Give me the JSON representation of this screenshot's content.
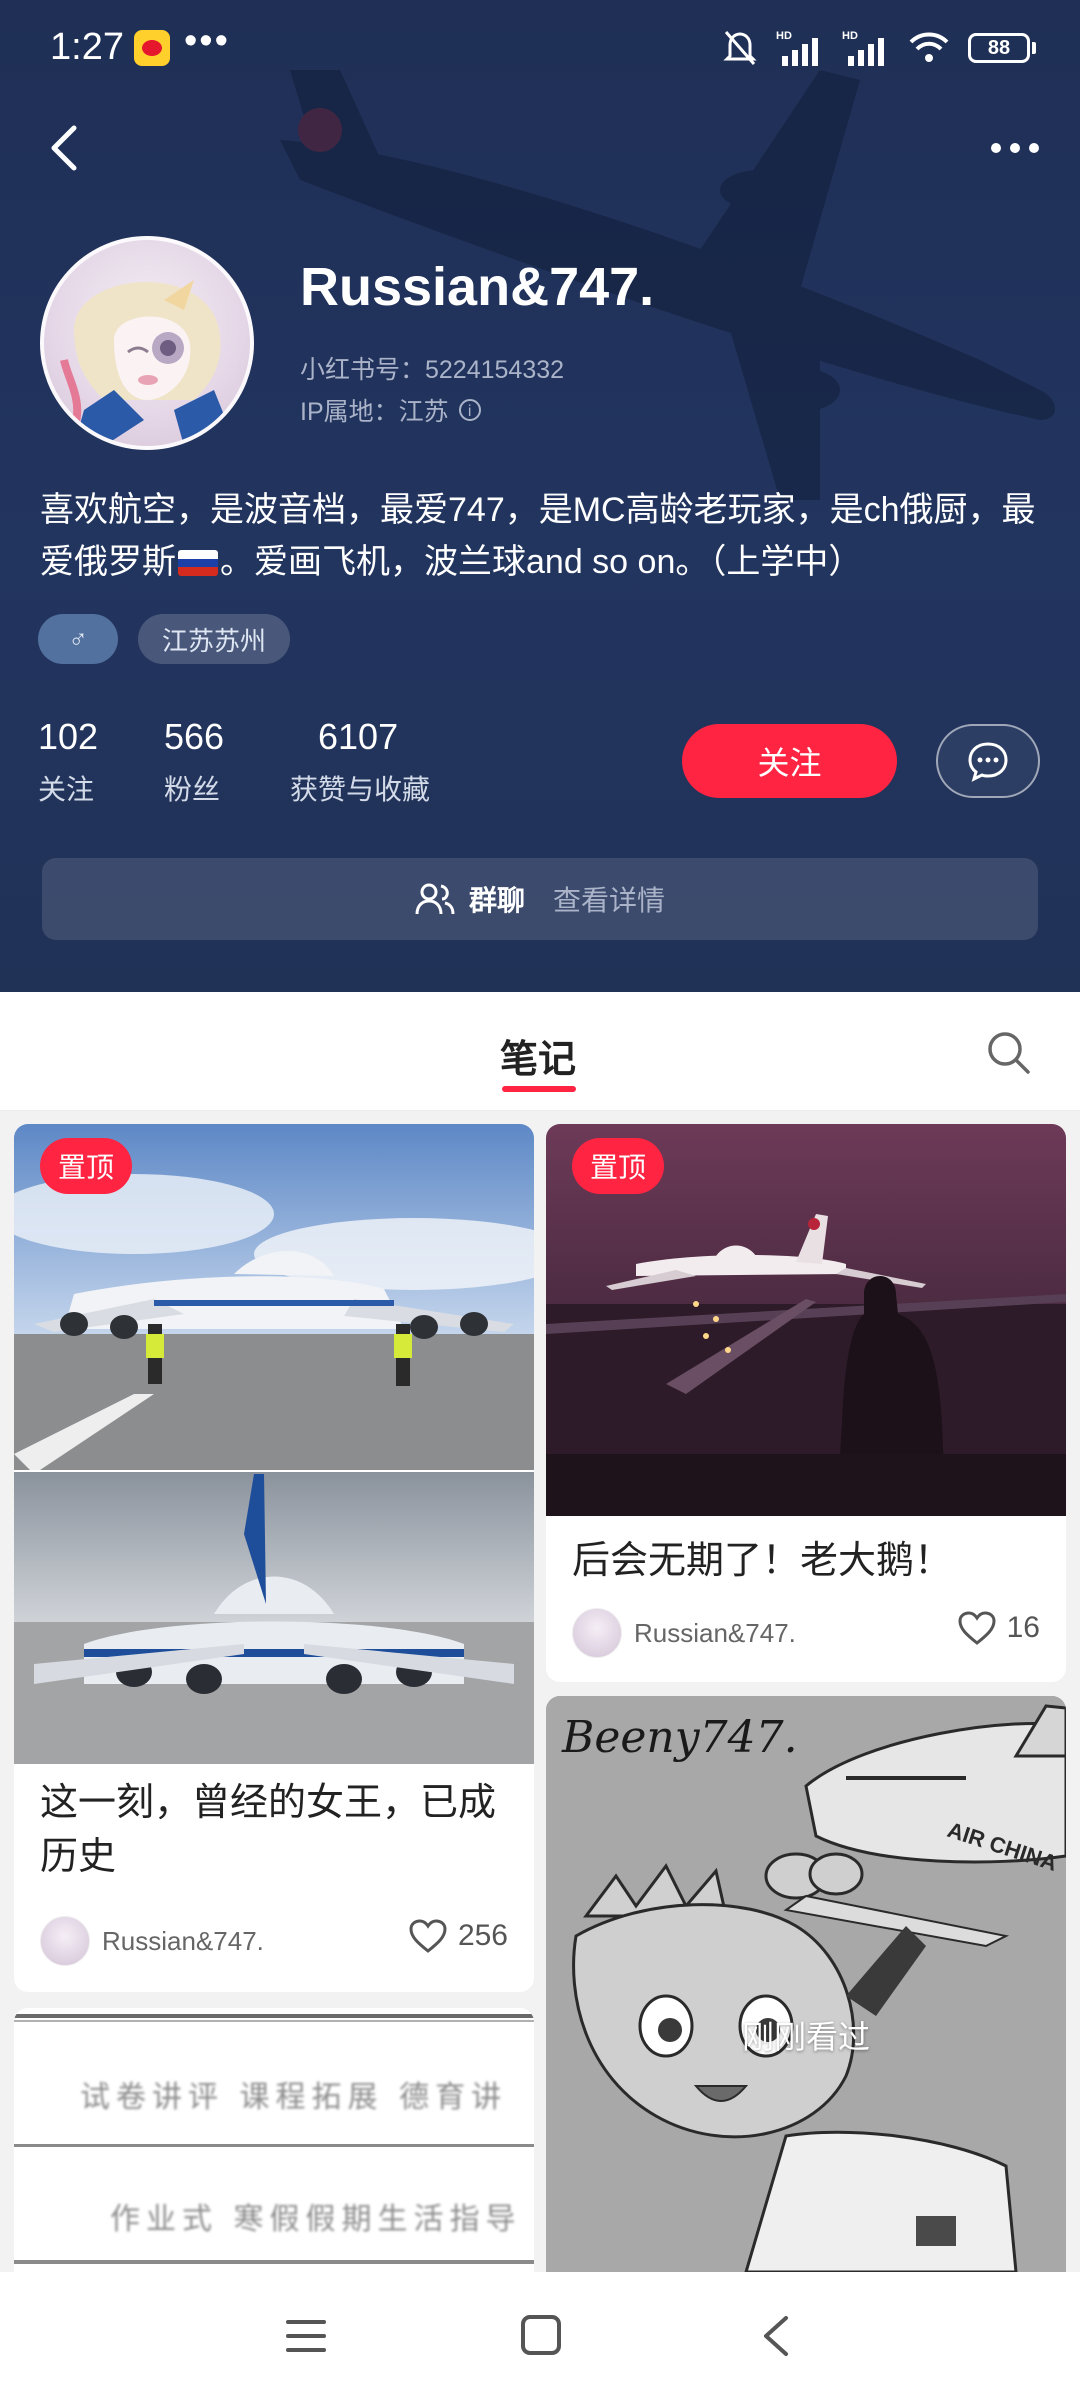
{
  "status_bar": {
    "time": "1:27",
    "dots": "•••",
    "battery": "88"
  },
  "profile": {
    "username": "Russian&747.",
    "red_id": "小红书号：5224154332",
    "ip_location": "IP属地：江苏",
    "bio_part1": "喜欢航空，是波音档，最爱747，是MC高龄老玩家，是ch俄厨，最爱俄罗斯",
    "bio_part2": "。爱画飞机，波兰球and so on。（上学中）",
    "gender_symbol": "♂",
    "location_tag": "江苏苏州",
    "stats": {
      "following_count": "102",
      "following_label": "关注",
      "followers_count": "566",
      "followers_label": "粉丝",
      "likes_count": "6107",
      "likes_label": "获赞与收藏"
    },
    "follow_button": "关注",
    "group_chat_label": "群聊",
    "group_chat_detail": "查看详情"
  },
  "tabs": {
    "notes_label": "笔记"
  },
  "notes": [
    {
      "pinned_label": "置顶",
      "title": "这一刻，曾经的女王，已成历史",
      "author": "Russian&747.",
      "likes": "256"
    },
    {
      "pinned_label": "置顶",
      "title": "后会无期了！老大鹅！",
      "author": "Russian&747.",
      "likes": "16"
    },
    {
      "image_text_line1": "试卷讲评  课程拓展  德育讲",
      "image_text_line2": "作业式  寒假假期生活指导"
    },
    {
      "image_signature": "Beeny747.",
      "just_viewed": "刚刚看过"
    }
  ],
  "colors": {
    "header_bg": "#22355f",
    "accent_red": "#ff2442",
    "card_bg": "#ffffff",
    "page_bg": "#f2f2f2"
  }
}
